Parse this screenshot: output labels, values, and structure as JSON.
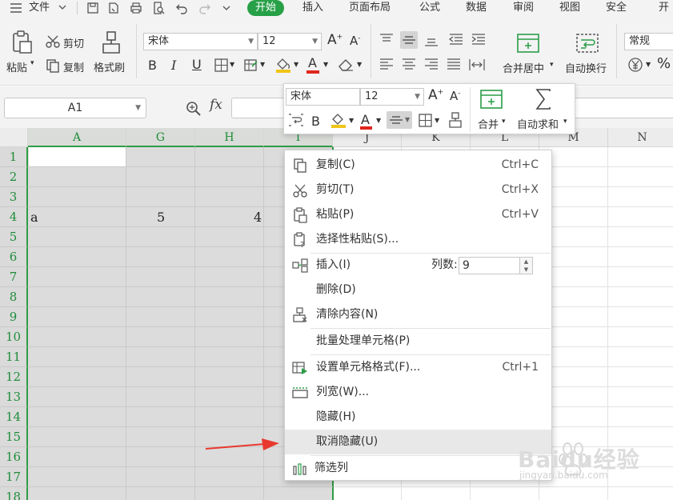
{
  "menubar": {
    "file_label": "文件",
    "tabs": [
      {
        "label": "开始",
        "active": true
      },
      {
        "label": "插入"
      },
      {
        "label": "页面布局"
      },
      {
        "label": "公式"
      },
      {
        "label": "数据"
      },
      {
        "label": "审阅"
      },
      {
        "label": "视图"
      },
      {
        "label": "安全"
      },
      {
        "label": "开发"
      }
    ]
  },
  "ribbon": {
    "paste_label": "粘贴",
    "cut_label": "剪切",
    "copy_label": "复制",
    "format_painter_label": "格式刷",
    "font_name": "宋体",
    "font_size": "12",
    "bold": "B",
    "italic": "I",
    "underline": "U",
    "merge_label": "合并居中",
    "wrap_label": "自动换行",
    "number_format": "常规"
  },
  "formulabar": {
    "cell_ref": "A1",
    "fx": "fx"
  },
  "grid": {
    "columns": [
      "A",
      "G",
      "H",
      "I",
      "J",
      "K",
      "L",
      "M",
      "N"
    ],
    "rows": [
      "1",
      "2",
      "3",
      "4",
      "5",
      "6",
      "7",
      "8",
      "9",
      "10",
      "11",
      "12",
      "13",
      "14",
      "15",
      "16",
      "17",
      "18"
    ],
    "cells": {
      "a4": "a",
      "g4": "5",
      "h4": "4"
    }
  },
  "minitoolbar": {
    "font_name": "宋体",
    "font_size": "12",
    "bold": "B",
    "merge_label": "合并",
    "autosum_label": "自动求和"
  },
  "contextmenu": {
    "items": [
      {
        "label": "复制(C)",
        "shortcut": "Ctrl+C"
      },
      {
        "label": "剪切(T)",
        "shortcut": "Ctrl+X"
      },
      {
        "label": "粘贴(P)",
        "shortcut": "Ctrl+V"
      },
      {
        "label": "选择性粘贴(S)..."
      },
      {
        "label": "插入(I)"
      },
      {
        "label": "删除(D)"
      },
      {
        "label": "清除内容(N)"
      },
      {
        "label": "批量处理单元格(P)"
      },
      {
        "label": "设置单元格格式(F)...",
        "shortcut": "Ctrl+1"
      },
      {
        "label": "列宽(W)..."
      },
      {
        "label": "隐藏(H)"
      },
      {
        "label": "取消隐藏(U)"
      },
      {
        "label": "筛选列"
      }
    ],
    "column_count_label": "列数:",
    "column_count_value": "9"
  },
  "watermark": {
    "brand": "Baidu经验",
    "url": "jingyan.baidu.com"
  },
  "colors": {
    "accent_green": "#27a048",
    "arrow_red": "#e8392f"
  }
}
